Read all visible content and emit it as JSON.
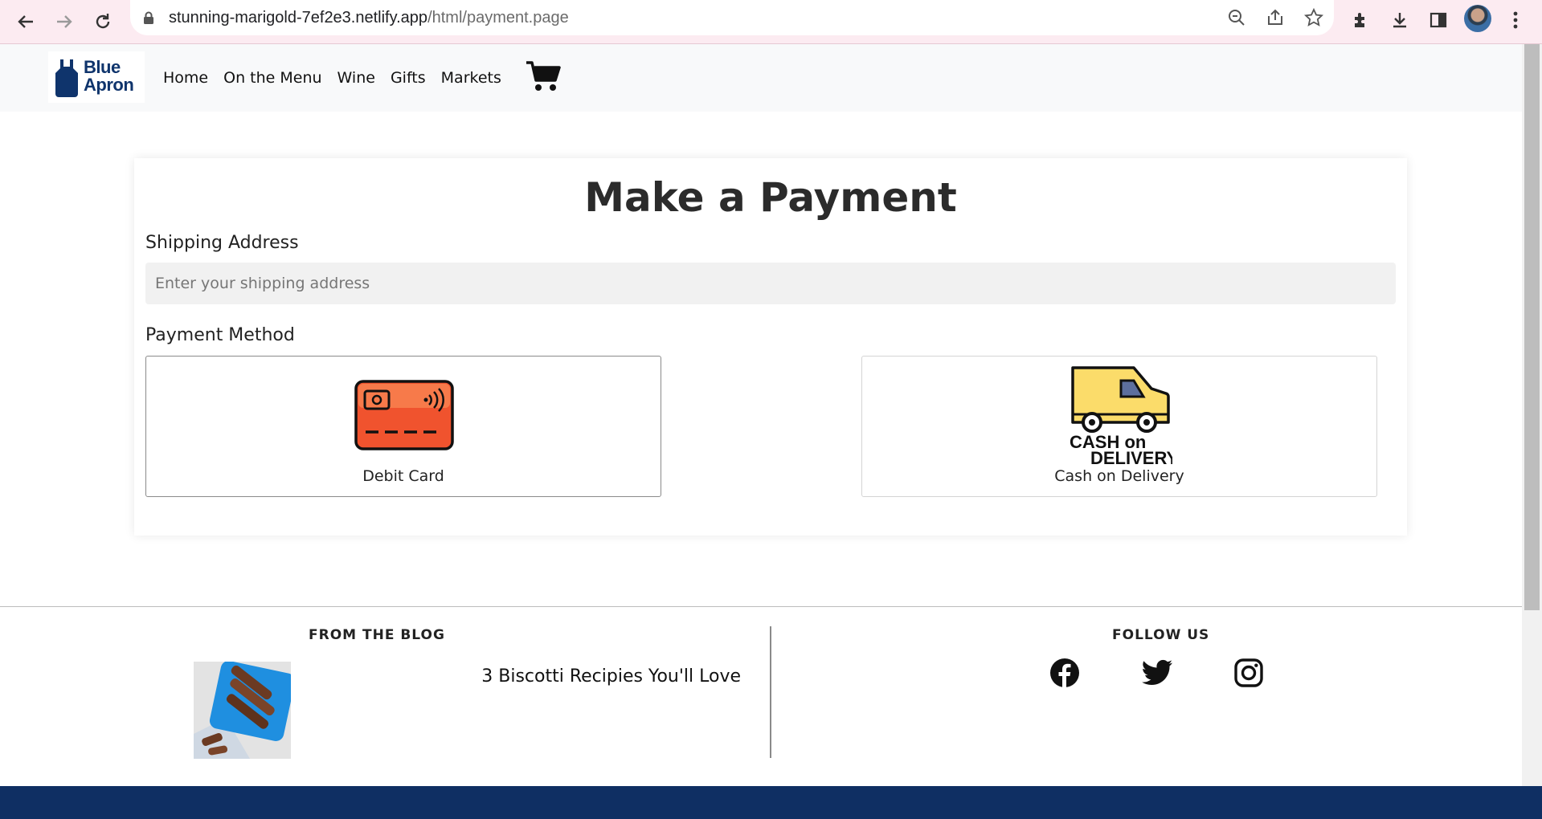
{
  "browser": {
    "url_domain": "stunning-marigold-7ef2e3.netlify.app",
    "url_path": "/html/payment.page"
  },
  "header": {
    "logo_line1": "Blue",
    "logo_line2": "Apron",
    "nav": [
      "Home",
      "On the Menu",
      "Wine",
      "Gifts",
      "Markets"
    ]
  },
  "payment": {
    "title": "Make a Payment",
    "shipping_label": "Shipping Address",
    "shipping_placeholder": "Enter your shipping address",
    "shipping_value": "",
    "method_label": "Payment Method",
    "methods": [
      {
        "label": "Debit Card",
        "icon": "credit-card-icon"
      },
      {
        "label": "Cash on Delivery",
        "icon": "delivery-van-icon",
        "image_text_1": "CASH on",
        "image_text_2": "DELIVERY"
      }
    ]
  },
  "footer": {
    "blog_heading": "FROM THE BLOG",
    "blog_post_title": "3 Biscotti Recipies You'll Love",
    "follow_heading": "FOLLOW US",
    "social": [
      "facebook-icon",
      "twitter-icon",
      "instagram-icon"
    ]
  },
  "colors": {
    "brand_navy": "#0f346c",
    "footer_bar": "#0f2f63",
    "card_orange": "#f0532e",
    "van_yellow": "#fbdc6a",
    "chrome_pink": "#fcebf1"
  }
}
